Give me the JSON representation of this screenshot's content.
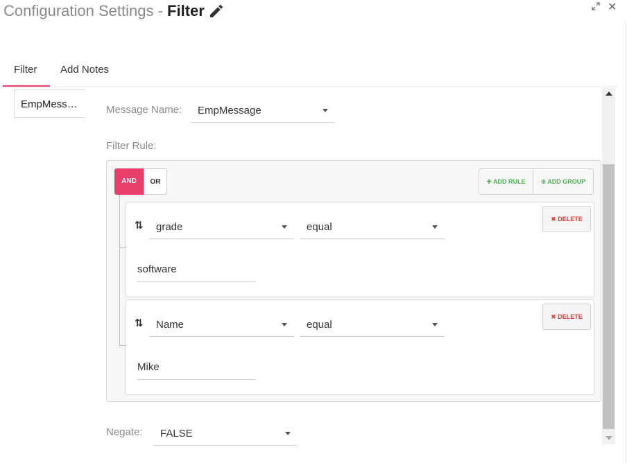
{
  "header": {
    "title_prefix": "Configuration Settings - ",
    "title_strong": "Filter",
    "close_glyph": "✕"
  },
  "tabs": [
    {
      "label": "Filter",
      "active": true
    },
    {
      "label": "Add Notes",
      "active": false
    }
  ],
  "left_list": {
    "items": [
      "EmpMess…"
    ]
  },
  "message_name": {
    "label": "Message Name:",
    "value": "EmpMessage"
  },
  "filter_rule": {
    "label": "Filter Rule:",
    "conditions": {
      "and_label": "AND",
      "or_label": "OR",
      "selected": "AND"
    },
    "add_rule_label": "ADD RULE",
    "add_group_label": "ADD GROUP",
    "rules": [
      {
        "field": "grade",
        "operator": "equal",
        "value": "software",
        "delete_label": "DELETE"
      },
      {
        "field": "Name",
        "operator": "equal",
        "value": "Mike",
        "delete_label": "DELETE"
      }
    ]
  },
  "negate": {
    "label": "Negate:",
    "value": "FALSE"
  },
  "colors": {
    "accent": "#e83e6c",
    "add_green": "#4caf50",
    "delete_red": "#e53935"
  },
  "icons": {
    "edit": "pencil-icon",
    "expand": "expand-icon",
    "close": "close-icon",
    "drag": "sort-arrows-icon",
    "add_rule": "plus-icon",
    "add_group": "plus-circle-icon",
    "delete": "x-icon"
  }
}
